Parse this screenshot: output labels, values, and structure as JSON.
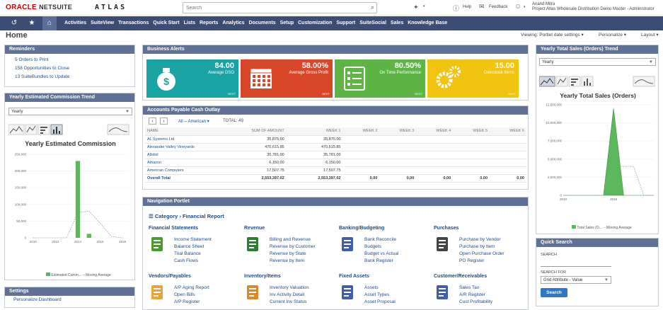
{
  "header": {
    "brand_red": "ORACLE",
    "brand_black": "NETSUITE",
    "atlas": "ATLAS",
    "search_placeholder": "Search",
    "help": "Help",
    "feedback": "Feedback",
    "user_name": "Anand Mitra",
    "user_role": "Project Atlas Wholesale Distribution Demo Master - Administrator"
  },
  "nav": {
    "items": [
      "Activities",
      "SuiteView",
      "Transactions",
      "Quick Start",
      "Lists",
      "Reports",
      "Analytics",
      "Documents",
      "Setup",
      "Customization",
      "Support",
      "SuiteSocial",
      "Sales",
      "Knowledge Base"
    ]
  },
  "page": {
    "title": "Home",
    "viewing": "Viewing: Portlet date settings",
    "personalize": "Personalize",
    "layout": "Layout"
  },
  "reminders": {
    "title": "Reminders",
    "items": [
      {
        "count": "5",
        "label": "Orders to Print"
      },
      {
        "count": "158",
        "label": "Opportunities to Close"
      },
      {
        "count": "13",
        "label": "SuiteBundles to Update"
      }
    ]
  },
  "commission": {
    "title": "Yearly Estimated Commission Trend",
    "select": "Yearly",
    "chart_title": "Yearly Estimated Commission",
    "legend_1": "Estimated Comm...",
    "legend_2": "Moving Average",
    "y_ticks": [
      "250,000",
      "200,000",
      "150,000",
      "100,000",
      "50,000",
      "0"
    ],
    "x_ticks": [
      "2010",
      "2012",
      "2014",
      "2016",
      "2018"
    ]
  },
  "settings": {
    "title": "Settings",
    "item": "Personalize Dashboard"
  },
  "alerts": {
    "title": "Business Alerts",
    "kpis": [
      {
        "value": "84.00",
        "label": "Average DSO",
        "mini": "NEXT",
        "color": "#1aa3a3"
      },
      {
        "value": "58.00%",
        "label": "Average Gross Profit",
        "mini": "NEXT",
        "color": "#d9472b"
      },
      {
        "value": "80.50%",
        "label": "On Time Performance",
        "mini": "NEXT",
        "color": "#5fb446"
      },
      {
        "value": "15.00",
        "label": "Overstock Items",
        "mini": "NEXT",
        "color": "#f1c40f"
      }
    ]
  },
  "ap": {
    "title": "Accounts Payable Cash Outlay",
    "filter": "All -- American",
    "total_label": "TOTAL:",
    "total_value": "49",
    "columns": [
      "NAME",
      "SUM OF AMOUNT",
      "WEEK 1",
      "WEEK 2",
      "WEEK 3",
      "WEEK 4",
      "WEEK 5",
      "WEEK 6"
    ],
    "rows": [
      [
        "AL Systems Ltd",
        "35,875.00",
        "35,875.00",
        "",
        "",
        "",
        "",
        ""
      ],
      [
        "Alexander Valley Vineyards",
        "470,615.85",
        "470,615.85",
        "",
        "",
        "",
        "",
        ""
      ],
      [
        "Allstisl",
        "35,781.00",
        "35,781.00",
        "",
        "",
        "",
        "",
        ""
      ],
      [
        "Amazon",
        "6,150.00",
        "6,150.00",
        "",
        "",
        "",
        "",
        ""
      ],
      [
        "American Computers",
        "17,507.75",
        "17,507.75",
        "",
        "",
        "",
        "",
        ""
      ],
      [
        "Overall Total",
        "2,553,397.02",
        "2,553,397.02",
        "0.00",
        "0.00",
        "0.00",
        "0.00",
        "0.00"
      ]
    ]
  },
  "navportlet": {
    "title": "Navigation Portlet",
    "crumb_1": "Category",
    "crumb_2": "Financial Report",
    "sections": [
      {
        "title": "Financial Statements",
        "links": [
          "Income Statement",
          "Balance Sheet",
          "Trial Balance",
          "Cash Flows"
        ]
      },
      {
        "title": "Revenue",
        "links": [
          "Billing and Revenue",
          "Revenue by Customer",
          "Revenue by State",
          "Revenue by Item"
        ]
      },
      {
        "title": "Banking/Budgeting",
        "links": [
          "Bank Reconcile",
          "Budgets",
          "Budget vs Actual",
          "Bank Register"
        ]
      },
      {
        "title": "Purchases",
        "links": [
          "Purchase by Vendor",
          "Purchase by Item",
          "Open Purchase Order",
          "PO Register"
        ]
      },
      {
        "title": "Vendors/Payables",
        "links": [
          "A/P Aging Report",
          "Open Bills",
          "A/P Register"
        ]
      },
      {
        "title": "Inventory/Items",
        "links": [
          "Inventory Valuation",
          "Inv Activity Detail",
          "Current Inv Status"
        ]
      },
      {
        "title": "Fixed Assets",
        "links": [
          "Assets",
          "Asset Types",
          "Asset Proposal"
        ]
      },
      {
        "title": "Customer/Receivables",
        "links": [
          "Sales Tax",
          "A/R Register",
          "Cust Profitability"
        ]
      }
    ]
  },
  "sales": {
    "title": "Yearly Total Sales (Orders) Trend",
    "select": "Yearly",
    "chart_title": "Yearly Total Sales (Orders)",
    "legend_1": "Total Sales (O...",
    "legend_2": "Moving Average",
    "y_ticks": [
      "12,500,000",
      "10,000,000",
      "7,500,000",
      "5,000,000",
      "2,500,000",
      "0"
    ],
    "x_ticks": [
      "2010",
      "2015"
    ]
  },
  "quicksearch": {
    "title": "Quick Search",
    "search_label": "SEARCH",
    "search_for_label": "SEARCH FOR",
    "search_for_value": "Grid Attribute - Value",
    "button": "Search"
  },
  "chart_data": [
    {
      "type": "bar",
      "title": "Yearly Estimated Commission",
      "categories": [
        "2010",
        "2011",
        "2012",
        "2013",
        "2014",
        "2015",
        "2016",
        "2017",
        "2018"
      ],
      "series": [
        {
          "name": "Estimated Comm...",
          "values": [
            0,
            0,
            0,
            0,
            230000,
            12000,
            0,
            0,
            0
          ]
        },
        {
          "name": "Moving Average",
          "values": [
            0,
            0,
            0,
            0,
            76000,
            80000,
            44000,
            4000,
            0
          ]
        }
      ],
      "ylim": [
        0,
        250000
      ]
    },
    {
      "type": "area",
      "title": "Yearly Total Sales (Orders)",
      "x": [
        "2010",
        "2011",
        "2012",
        "2013",
        "2014",
        "2015",
        "2016",
        "2017",
        "2018",
        "2019"
      ],
      "series": [
        {
          "name": "Total Sales (O...",
          "values": [
            0,
            0,
            0,
            0,
            0,
            12000000,
            0,
            0,
            0,
            0
          ]
        },
        {
          "name": "Moving Average",
          "values": [
            0,
            0,
            0,
            0,
            0,
            4000000,
            4000000,
            4000000,
            0,
            0
          ]
        }
      ],
      "ylim": [
        0,
        12500000
      ]
    }
  ]
}
